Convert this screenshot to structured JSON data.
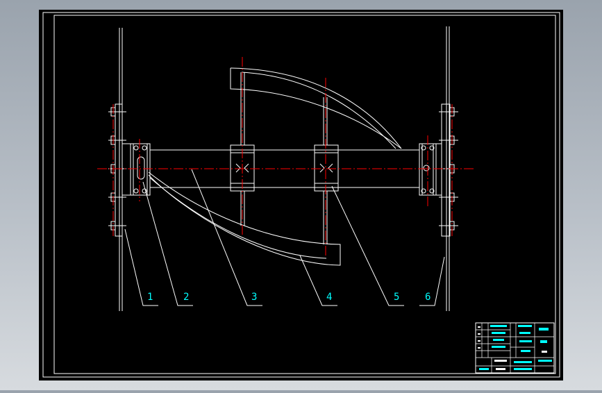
{
  "drawing": {
    "part_numbers": [
      "1",
      "2",
      "3",
      "4",
      "5",
      "6"
    ]
  },
  "colors": {
    "sheet_background": "#000000",
    "line_white": "#ffffff",
    "centerline_red": "#ff0000",
    "label_cyan": "#00ffff",
    "viewport_background": "#a9b1ba"
  }
}
